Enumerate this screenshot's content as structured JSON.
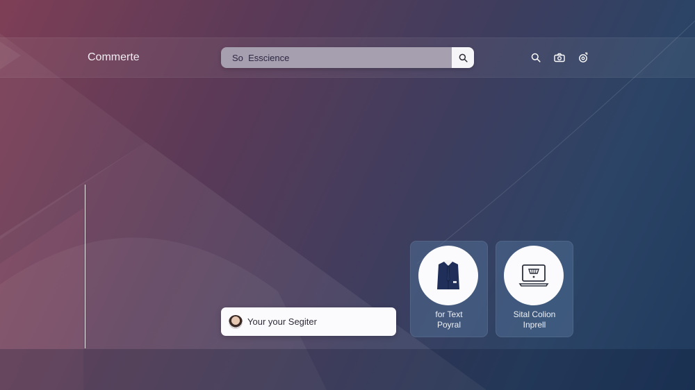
{
  "header": {
    "brand": "Commerte",
    "search": {
      "value": "So  Esscience",
      "placeholder": ""
    },
    "icons": [
      "search-icon",
      "camera-icon",
      "settings-icon"
    ]
  },
  "user_card": {
    "label": "Your your Segiter"
  },
  "tiles": [
    {
      "icon": "suit-icon",
      "line1": "for Text",
      "line2": "Poyral"
    },
    {
      "icon": "laptop-icon",
      "line1": "Sital Colion",
      "line2": "Inprell"
    }
  ],
  "colors": {
    "bg_left": "#7e3f56",
    "bg_right": "#1f3a5d",
    "search_field": "#a59fb0",
    "tile_bg": "#4e6c92",
    "suit": "#1f2f5a"
  }
}
